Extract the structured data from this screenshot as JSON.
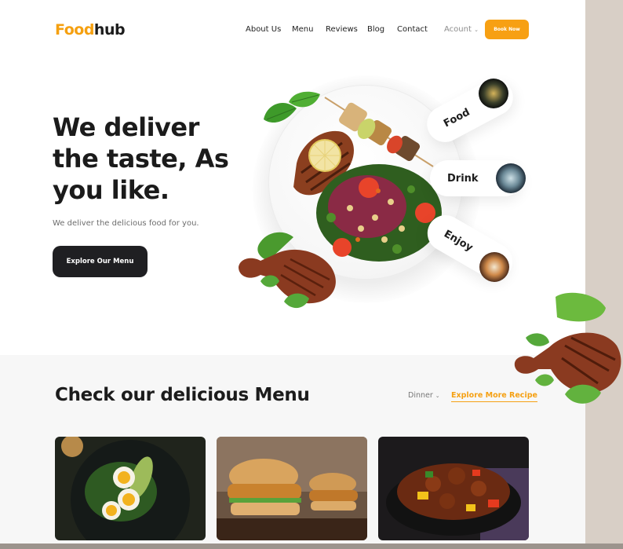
{
  "header": {
    "logo_part1": "Food",
    "logo_part2": "hub",
    "nav": [
      "About Us",
      "Menu",
      "Reviews",
      "Blog",
      "Contact"
    ],
    "account_label": "Acount",
    "book_label": "Book Now"
  },
  "hero": {
    "title": "We deliver the taste, As you like.",
    "subtitle": "We deliver the delicious food for you.",
    "cta_label": "Explore Our Menu",
    "tags": [
      "Food",
      "Drink",
      "Enjoy"
    ]
  },
  "menu": {
    "title": "Check our delicious Menu",
    "filter_value": "Dinner",
    "explore_label": "Explore More Recipe",
    "cards": [
      "egg-avocado-salad",
      "fried-chicken-burger",
      "spicy-stir-fry"
    ]
  },
  "colors": {
    "accent": "#f7a013",
    "dark": "#1f1f22",
    "section_bg": "#f7f7f7"
  },
  "icons": {
    "chevron": "chevron-down-icon"
  }
}
